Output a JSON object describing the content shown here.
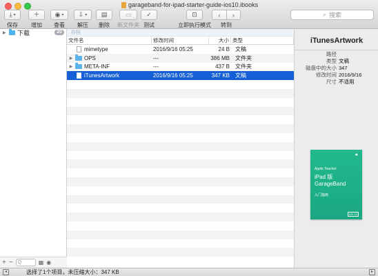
{
  "window": {
    "title": "garageband-for-ipad-starter-guide-ios10.ibooks"
  },
  "toolbar": {
    "items": [
      {
        "label": "保存",
        "icon": "save-icon",
        "glyph": "⤓"
      },
      {
        "label": "增加",
        "icon": "add-icon",
        "glyph": "＋"
      },
      {
        "label": "查看",
        "icon": "eye-icon",
        "glyph": "◉"
      },
      {
        "label": "解压",
        "icon": "extract-icon",
        "glyph": "⇩"
      },
      {
        "label": "删除",
        "icon": "trash-icon",
        "glyph": "▤"
      },
      {
        "label": "新文件夹",
        "icon": "new-folder-icon",
        "glyph": "▭"
      },
      {
        "label": "测试",
        "icon": "checkmark-icon",
        "glyph": "✓"
      },
      {
        "label": "立即执行模式",
        "icon": "lock-icon",
        "glyph": "⊡"
      }
    ],
    "nav_label": "转到",
    "search_placeholder": "搜索"
  },
  "sidebar": {
    "item_label": "下载",
    "item_badge": "20",
    "filter_placeholder": "Q"
  },
  "list": {
    "path_label": "存档",
    "columns": {
      "name": "文件名",
      "date": "修改时间",
      "size": "大小",
      "kind": "类型"
    },
    "rows": [
      {
        "name": "mimetype",
        "date": "2016/9/16 05:25",
        "size": "24 B",
        "kind": "文稿",
        "type": "file",
        "expandable": false,
        "selected": false
      },
      {
        "name": "OPS",
        "date": "---",
        "size": "386 MB",
        "kind": "文件夹",
        "type": "folder",
        "expandable": true,
        "selected": false
      },
      {
        "name": "META-INF",
        "date": "---",
        "size": "437 B",
        "kind": "文件夹",
        "type": "folder",
        "expandable": true,
        "selected": false
      },
      {
        "name": "iTunesArtwork",
        "date": "2016/9/16 05:25",
        "size": "347 KB",
        "kind": "文稿",
        "type": "file",
        "expandable": false,
        "selected": true
      }
    ]
  },
  "inspector": {
    "title": "iTunesArtwork",
    "fields": [
      {
        "key": "路径",
        "value": ""
      },
      {
        "key": "类型",
        "value": "文稿"
      },
      {
        "key": "磁盘中的大小",
        "value": "347"
      },
      {
        "key": "修改时间",
        "value": "2016/9/16"
      },
      {
        "key": "尺寸",
        "value": "不适用"
      }
    ],
    "preview": {
      "line1": "Apple Teacher",
      "title_line1": "iPad 版",
      "title_line2": "GarageBand",
      "subtitle": "入门指南",
      "tag": "iOS 10"
    }
  },
  "status": {
    "text": "选择了1个项目，未压缩大小：347 KB"
  },
  "colors": {
    "selection": "#1560d6",
    "folder": "#58b4ea",
    "preview_green": "#1fae87"
  }
}
